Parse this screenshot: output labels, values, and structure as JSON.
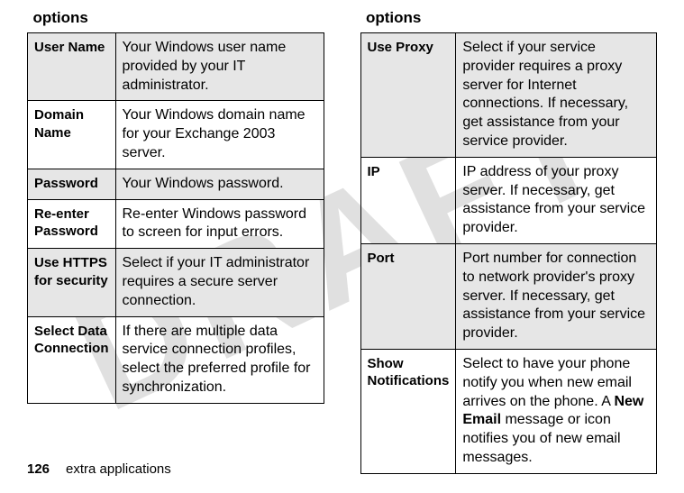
{
  "watermark": "DRAFT",
  "left": {
    "header": "options",
    "rows": [
      {
        "opt": "User Name",
        "desc": "Your Windows user name provided by your IT administrator.",
        "shaded": true
      },
      {
        "opt": "Domain Name",
        "desc": "Your Windows domain name for your Exchange 2003 server.",
        "shaded": false
      },
      {
        "opt": "Password",
        "desc": "Your Windows password.",
        "shaded": true
      },
      {
        "opt": "Re-enter Password",
        "desc": "Re-enter Windows password to screen for input errors.",
        "shaded": false
      },
      {
        "opt": "Use HTTPS for security",
        "desc": "Select if your IT administrator requires a secure server connection.",
        "shaded": true
      },
      {
        "opt": "Select Data Connection",
        "desc": "If there are multiple data service connection profiles, select the preferred profile for synchronization.",
        "shaded": false
      }
    ]
  },
  "right": {
    "header": "options",
    "rows": [
      {
        "opt": "Use Proxy",
        "desc": "Select if your service provider requires a proxy server for Internet connections. If necessary, get assistance from your service provider.",
        "shaded": true
      },
      {
        "opt": "IP",
        "desc": "IP address of your proxy server. If necessary, get assistance from your service provider.",
        "shaded": false
      },
      {
        "opt": "Port",
        "desc": "Port number for connection to network provider's proxy server. If necessary, get assistance from your service provider.",
        "shaded": true
      },
      {
        "opt": "Show Notifications",
        "desc_pre": "Select to have your phone notify you when new email arrives on the phone. A ",
        "desc_bold": "New Email",
        "desc_post": " message or icon notifies you of new email messages.",
        "shaded": false
      }
    ]
  },
  "footer": {
    "page": "126",
    "section": "extra applications"
  }
}
